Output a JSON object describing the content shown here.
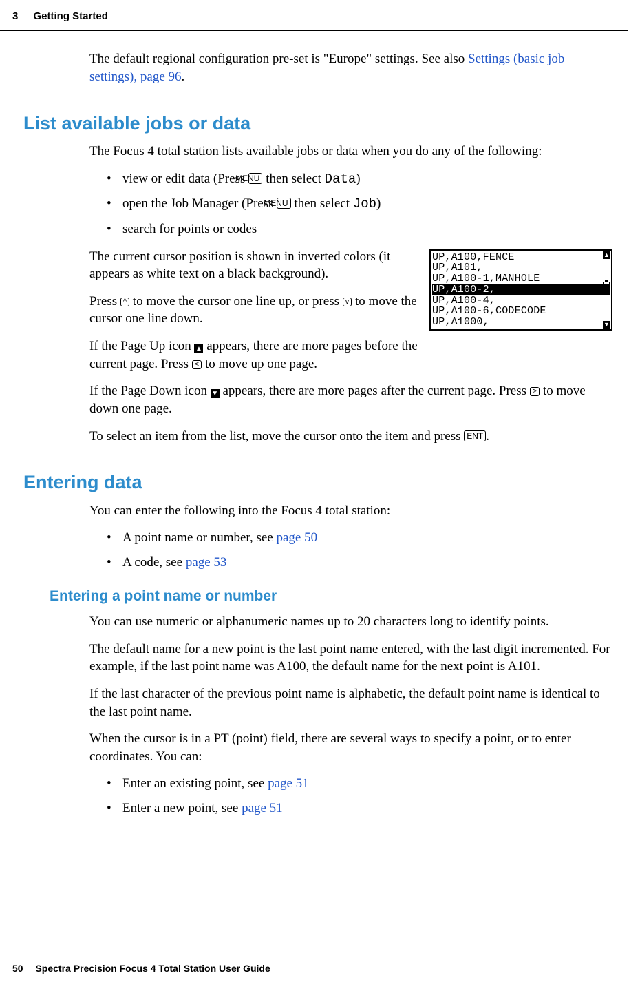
{
  "header": {
    "chapter": "3",
    "title": "Getting Started"
  },
  "intro": {
    "p1a": "The default regional configuration pre-set is \"Europe\" settings. See also ",
    "p1link": "Settings (basic job settings), page 96",
    "p1b": "."
  },
  "sec1": {
    "heading": "List available jobs or data",
    "p1": "The Focus 4 total station lists available jobs or data when you do any of the following:",
    "li1a": "view or edit data (Press ",
    "li1b": " then select ",
    "li1c": ")",
    "key_menu": "MENU",
    "sel_data": "Data",
    "li2a": "open the Job Manager (Press ",
    "li2b": " then select ",
    "li2c": ")",
    "sel_job": "Job",
    "li3": "search for points or codes",
    "p2": "The current cursor position is shown in inverted colors (it appears as white text on a black background).",
    "p3a": "Press ",
    "p3b": " to move the cursor one line up, or press ",
    "p3c": " to move the cursor one line down.",
    "key_up": "^",
    "key_dn": "v",
    "p4a": "If the Page Up icon ",
    "p4b": " appears, there are more pages before the current page. Press ",
    "p4c": " to move up one page.",
    "key_left": "<",
    "icon_up": "▲",
    "p5a": "If the Page Down icon ",
    "p5b": " appears, there are more pages after the current page. Press ",
    "p5c": " to move down one page.",
    "key_right": ">",
    "icon_dn": "▼",
    "p6a": "To select an item from the list, move the cursor onto the item and press ",
    "p6b": ".",
    "key_ent": "ENT",
    "lcd": {
      "r1": "UP,A100,FENCE",
      "r2": "UP,A101,",
      "r3": "UP,A100-1,MANHOLE",
      "r4": "UP,A100-2,",
      "r5": "UP,A100-4,",
      "r6": "UP,A100-6,CODECODE",
      "r7": "UP,A1000,"
    }
  },
  "sec2": {
    "heading": "Entering data",
    "p1": "You can enter the following into the Focus 4 total station:",
    "li1a": "A point name or number, see ",
    "li1link": "page 50",
    "li2a": "A code, see ",
    "li2link": "page 53"
  },
  "sec3": {
    "heading": "Entering a point name or number",
    "p1": "You can use numeric or alphanumeric names up to 20 characters long to identify points.",
    "p2": "The default name for a new point is the last point name entered, with the last digit incremented. For example, if the last point name was A100, the default name for the next point is A101.",
    "p3": "If the last character of the previous point name is alphabetic, the default point name is identical to the last point name.",
    "p4": "When the cursor is in a PT (point) field, there are several ways to specify a point, or to enter coordinates. You can:",
    "li1a": "Enter an existing point, see ",
    "li1link": "page 51",
    "li2a": "Enter a new point, see ",
    "li2link": "page 51"
  },
  "footer": {
    "page": "50",
    "title": "Spectra Precision Focus 4 Total Station User Guide"
  }
}
